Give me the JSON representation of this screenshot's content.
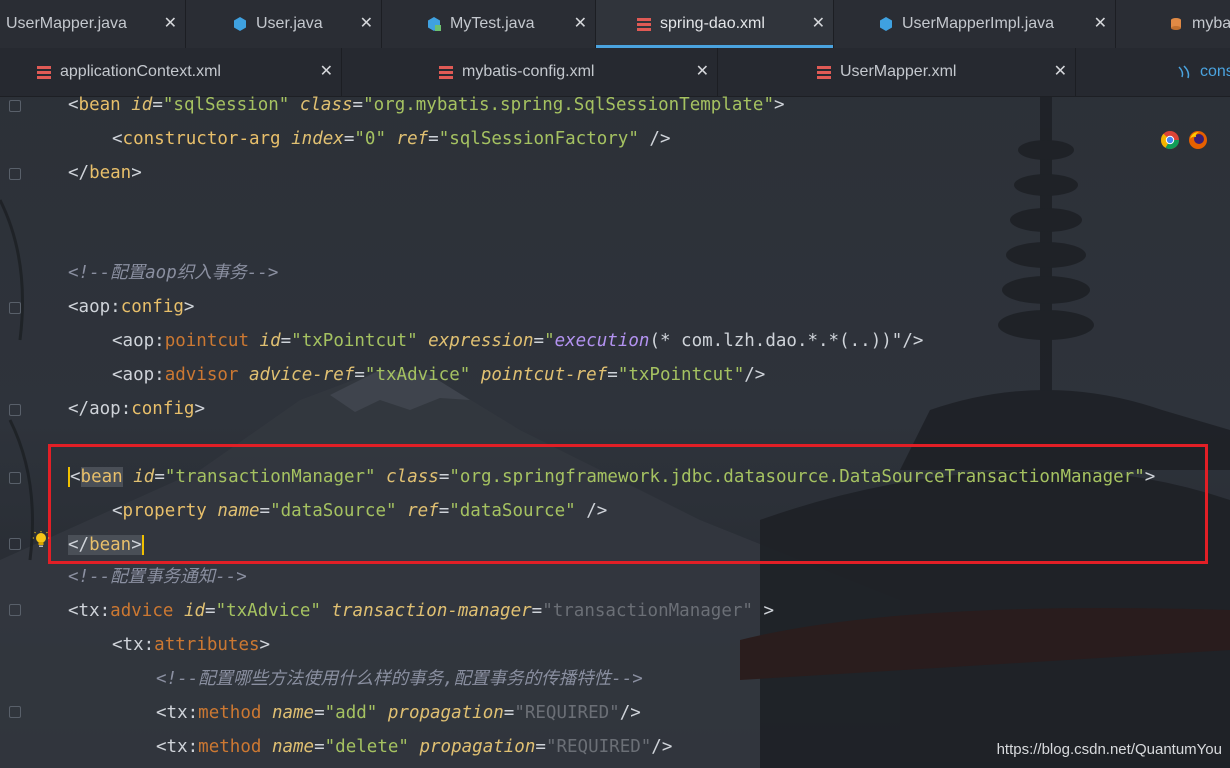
{
  "tabs_row1": [
    {
      "label": "UserMapper.java",
      "icon": "java-file-icon",
      "active": false
    },
    {
      "label": "User.java",
      "icon": "class-icon",
      "active": false
    },
    {
      "label": "MyTest.java",
      "icon": "test-class-icon",
      "active": false
    },
    {
      "label": "spring-dao.xml",
      "icon": "xml-file-icon",
      "active": true
    },
    {
      "label": "UserMapperImpl.java",
      "icon": "class-icon",
      "active": false
    },
    {
      "label": "myba",
      "icon": "database-icon",
      "active": false
    }
  ],
  "tabs_row2": [
    {
      "label": "applicationContext.xml",
      "icon": "xml-file-icon"
    },
    {
      "label": "mybatis-config.xml",
      "icon": "xml-file-icon"
    },
    {
      "label": "UserMapper.xml",
      "icon": "xml-file-icon"
    },
    {
      "label": "cons",
      "icon": "file-icon"
    }
  ],
  "close_glyph": "✕",
  "code": {
    "l1": {
      "tag": "bean",
      "a1": "id",
      "v1": "\"sqlSession\"",
      "a2": "class",
      "v2": "\"org.mybatis.spring.SqlSessionTemplate\""
    },
    "l2": {
      "tag": "constructor-arg",
      "a1": "index",
      "v1": "\"0\"",
      "a2": "ref",
      "v2": "\"sqlSessionFactory\""
    },
    "l3": {
      "tag": "bean"
    },
    "l4": {
      "comment": "<!--配置aop织入事务-->"
    },
    "l5": {
      "ns": "aop",
      "name": "config"
    },
    "l6": {
      "ns": "aop",
      "name": "pointcut",
      "a1": "id",
      "v1": "\"txPointcut\"",
      "a2": "expression",
      "v2a": "\"",
      "fn": "execution",
      "v2b": "(* com.lzh.dao.*.*(..))\""
    },
    "l7": {
      "ns": "aop",
      "name": "advisor",
      "a1": "advice-ref",
      "v1": "\"txAdvice\"",
      "a2": "pointcut-ref",
      "v2": "\"txPointcut\""
    },
    "l8": {
      "ns": "aop",
      "name": "config"
    },
    "l9": {
      "tag": "bean",
      "a1": "id",
      "v1": "\"transactionManager\"",
      "a2": "class",
      "v2": "\"org.springframework.jdbc.datasource.DataSourceTransactionManager\""
    },
    "l10": {
      "tag": "property",
      "a1": "name",
      "v1": "\"dataSource\"",
      "a2": "ref",
      "v2": "\"dataSource\""
    },
    "l11": {
      "tag": "bean"
    },
    "l12": {
      "comment": "<!--配置事务通知-->"
    },
    "l13": {
      "ns": "tx",
      "name": "advice",
      "a1": "id",
      "v1": "\"txAdvice\"",
      "a2": "transaction-manager",
      "v2": "\"transactionManager\""
    },
    "l14": {
      "ns": "tx",
      "name": "attributes"
    },
    "l15": {
      "comment": "<!--配置哪些方法使用什么样的事务,配置事务的传播特性-->"
    },
    "l16": {
      "ns": "tx",
      "name": "method",
      "a1": "name",
      "v1": "\"add\"",
      "a2": "propagation",
      "v2": "\"REQUIRED\""
    },
    "l17": {
      "ns": "tx",
      "name": "method",
      "a1": "name",
      "v1": "\"delete\"",
      "a2": "propagation",
      "v2": "\"REQUIRED\""
    }
  },
  "watermark": "https://blog.csdn.net/QuantumYou",
  "colors": {
    "highlight_box": "#e21f26",
    "active_tab_underline": "#4aa3df"
  }
}
